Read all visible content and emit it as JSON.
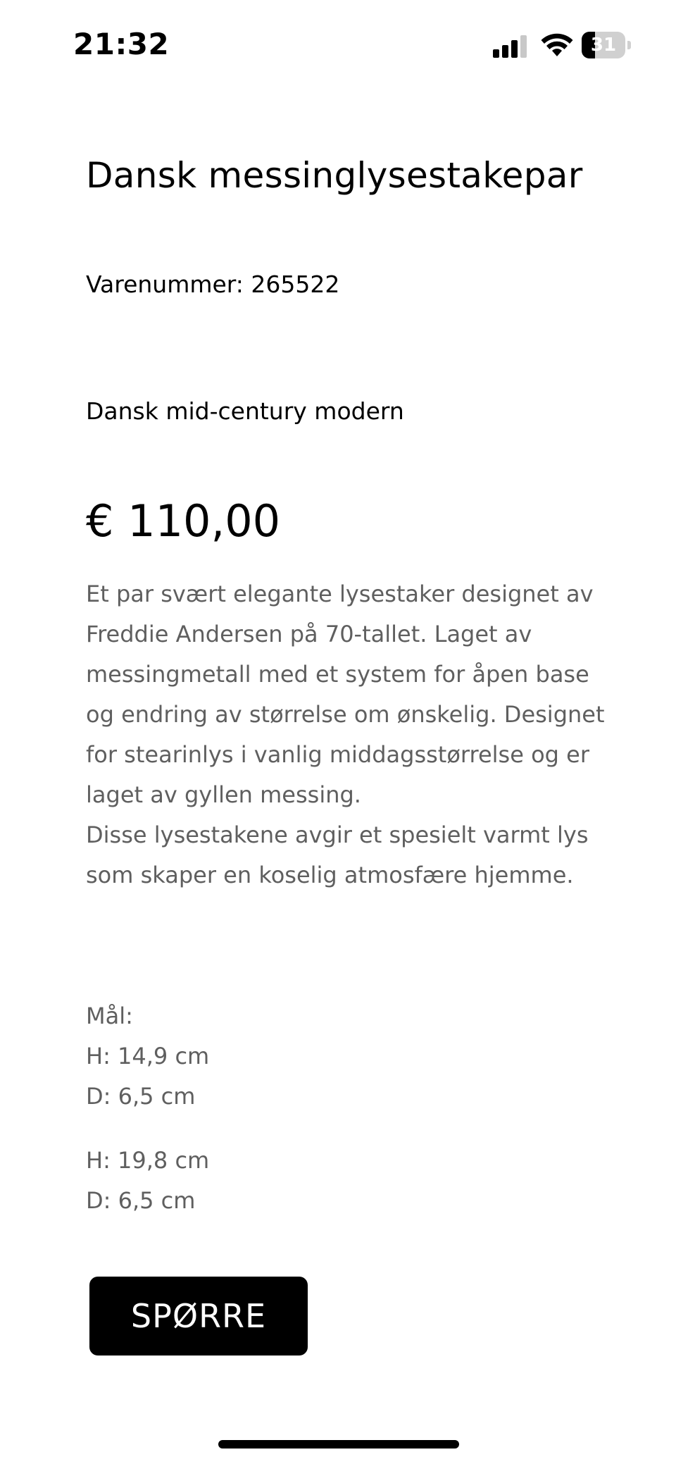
{
  "status_bar": {
    "time": "21:32",
    "battery_level": "31",
    "battery_fraction": 0.31,
    "icons": [
      "signal-icon",
      "wifi-icon",
      "battery-icon"
    ]
  },
  "product": {
    "title": "Dansk messinglysestakepar",
    "sku_label": "Varenummer:",
    "sku_value": "265522",
    "subtitle": "Dansk mid-century modern",
    "price": "€ 110,00",
    "description": [
      "Et par svært elegante lysestaker designet av Freddie Andersen på 70-tallet. Laget av messingmetall med et system for åpen base og endring av størrelse om ønskelig. Designet for stearinlys i vanlig middagsstørrelse og er laget av gyllen messing.",
      "Disse lysestakene avgir et spesielt varmt lys som skaper en koselig atmosfære hjemme."
    ],
    "dimensions_label": "Mål:",
    "dimensions": [
      {
        "height": "H: 14,9 cm",
        "diameter": "D: 6,5 cm"
      },
      {
        "height": "H: 19,8 cm",
        "diameter": "D: 6,5 cm"
      }
    ]
  },
  "actions": {
    "inquire_label": "SPØRRE"
  },
  "colors": {
    "text": "#000000",
    "body_text": "#5f5f5f",
    "button_bg": "#000000",
    "button_text": "#ffffff"
  }
}
